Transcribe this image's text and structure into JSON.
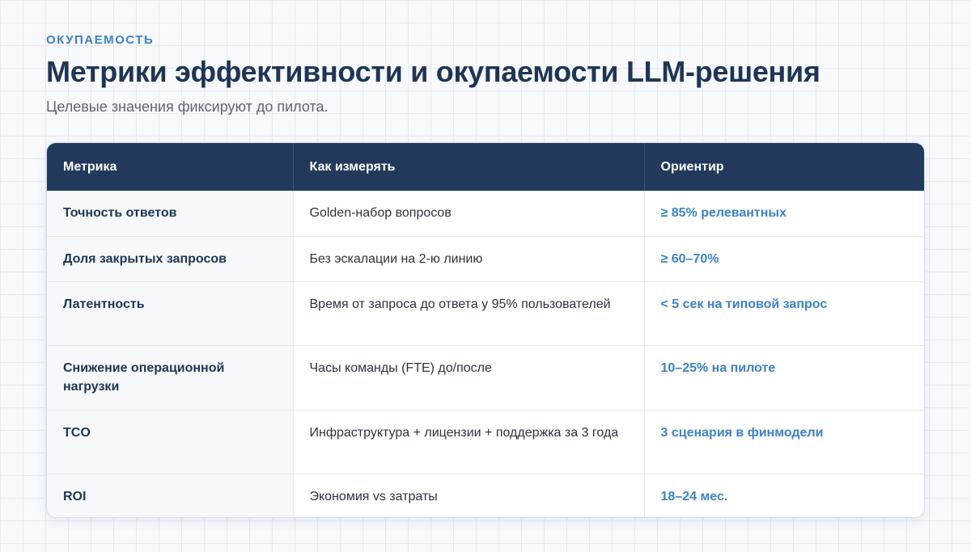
{
  "header": {
    "eyebrow": "ОКУПАЕМОСТЬ",
    "title": "Метрики эффективности и окупаемости LLM-решения",
    "subtitle": "Целевые значения фиксируют до пилота."
  },
  "table": {
    "columns": [
      "Метрика",
      "Как измерять",
      "Ориентир"
    ],
    "rows": [
      {
        "metric": "Точность ответов",
        "method": "Golden-набор вопросов",
        "target": "≥ 85% релевантных"
      },
      {
        "metric": "Доля закрытых запросов",
        "method": "Без эскалации на 2-ю линию",
        "target": "≥ 60–70%"
      },
      {
        "metric": "Латентность",
        "method": "Время от запроса до ответа у 95% пользователей",
        "target": "< 5 сек на типовой запрос"
      },
      {
        "metric": "Снижение операционной нагрузки",
        "method": "Часы команды (FTE) до/после",
        "target": "10–25% на пилоте"
      },
      {
        "metric": "TCO",
        "method": "Инфраструктура + лицензии + поддержка за 3 года",
        "target": "3 сценария в финмодели"
      },
      {
        "metric": "ROI",
        "method": "Экономия vs затраты",
        "target": "18–24 мес."
      }
    ]
  }
}
